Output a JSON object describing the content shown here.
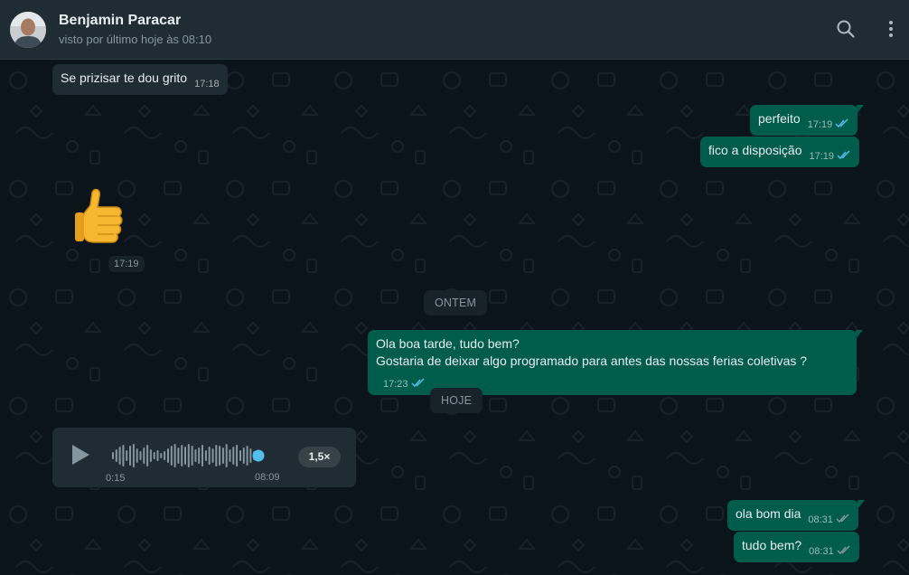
{
  "header": {
    "contact_name": "Benjamin Paracar",
    "contact_status": "visto por último hoje às 08:10"
  },
  "messages": [
    {
      "direction": "in",
      "text": "Se prizisar te dou grito",
      "time": "17:18"
    },
    {
      "direction": "out",
      "text": "perfeito",
      "time": "17:19",
      "status": "read"
    },
    {
      "direction": "out",
      "text": "fico a disposição",
      "time": "17:19",
      "status": "read"
    },
    {
      "direction": "in",
      "type": "emoji",
      "emoji": "thumbs-up",
      "time": "17:19"
    },
    {
      "direction": "out",
      "line1": "Ola boa tarde, tudo bem?",
      "line2": "Gostaria de deixar algo programado para antes das nossas ferias coletivas ?",
      "time": "17:23",
      "status": "read"
    },
    {
      "direction": "in",
      "type": "voice",
      "elapsed": "0:15",
      "time": "08:09",
      "speed": "1,5×",
      "progress": 1.0
    },
    {
      "direction": "out",
      "text": "ola bom dia",
      "time": "08:31",
      "status": "delivered"
    },
    {
      "direction": "out",
      "text": "tudo bem?",
      "time": "08:31",
      "status": "delivered"
    }
  ],
  "date_dividers": [
    "ONTEM",
    "HOJE"
  ],
  "colors": {
    "header_bg": "#202c33",
    "chat_bg": "#0b141a",
    "incoming_bubble": "#202c33",
    "outgoing_bubble": "#005c4b",
    "read_ticks": "#53bdeb",
    "delivered_ticks": "#8696a0"
  },
  "icons": {
    "search": "search-icon",
    "menu": "more-vertical-icon",
    "play": "play-icon",
    "read_receipt": "double-check-icon"
  }
}
